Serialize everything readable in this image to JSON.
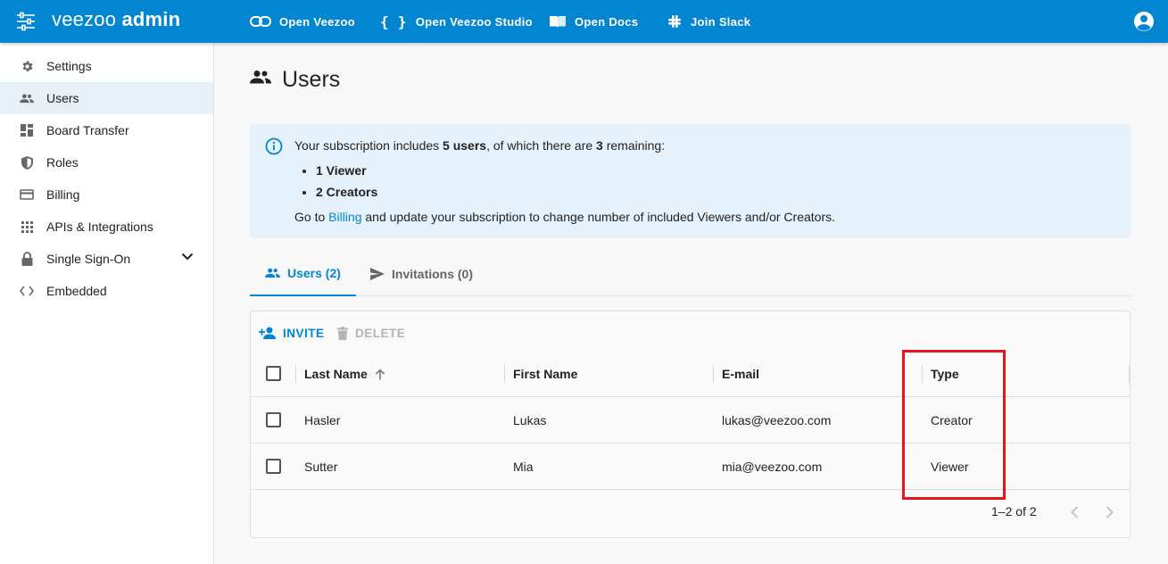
{
  "topbar": {
    "brand_left": "veezoo",
    "brand_right": "admin",
    "nav": [
      {
        "label": "Open Veezoo",
        "icon": "link-icon"
      },
      {
        "label": "Open Veezoo Studio",
        "icon": "code-braces-icon"
      },
      {
        "label": "Open Docs",
        "icon": "book-icon"
      },
      {
        "label": "Join Slack",
        "icon": "slack-icon"
      }
    ],
    "account_icon": "account-circle-icon"
  },
  "sidebar": {
    "items": [
      {
        "label": "Settings",
        "icon": "gear-icon"
      },
      {
        "label": "Users",
        "icon": "users-icon"
      },
      {
        "label": "Board Transfer",
        "icon": "dashboard-icon"
      },
      {
        "label": "Roles",
        "icon": "shield-icon"
      },
      {
        "label": "Billing",
        "icon": "credit-card-icon"
      },
      {
        "label": "APIs & Integrations",
        "icon": "apps-grid-icon"
      },
      {
        "label": "Single Sign-On",
        "icon": "lock-icon"
      },
      {
        "label": "Embedded",
        "icon": "code-icon"
      }
    ],
    "active": "Users"
  },
  "page": {
    "title": "Users"
  },
  "info": {
    "line1_pre": "Your subscription includes ",
    "line1_users": "5 users",
    "line1_mid": ", of which there are ",
    "line1_remaining": "3",
    "line1_post": " remaining:",
    "bullets": [
      "1 Viewer",
      "2 Creators"
    ],
    "line3_pre": "Go to ",
    "line3_link": "Billing",
    "line3_post": " and update your subscription to change number of included Viewers and/or Creators."
  },
  "tabs": [
    {
      "label": "Users (2)",
      "icon": "users-icon"
    },
    {
      "label": "Invitations (0)",
      "icon": "send-icon"
    }
  ],
  "toolbar": {
    "invite_label": "INVITE",
    "delete_label": "DELETE"
  },
  "table": {
    "columns": [
      "Last Name",
      "First Name",
      "E-mail",
      "Type"
    ],
    "rows": [
      {
        "last": "Hasler",
        "first": "Lukas",
        "email": "lukas@veezoo.com",
        "type": "Creator"
      },
      {
        "last": "Sutter",
        "first": "Mia",
        "email": "mia@veezoo.com",
        "type": "Viewer"
      }
    ],
    "pagination": "1–2 of 2"
  },
  "colors": {
    "primary": "#0386d1",
    "info_bg": "#e5f2fb",
    "highlight": "#e8141b"
  }
}
